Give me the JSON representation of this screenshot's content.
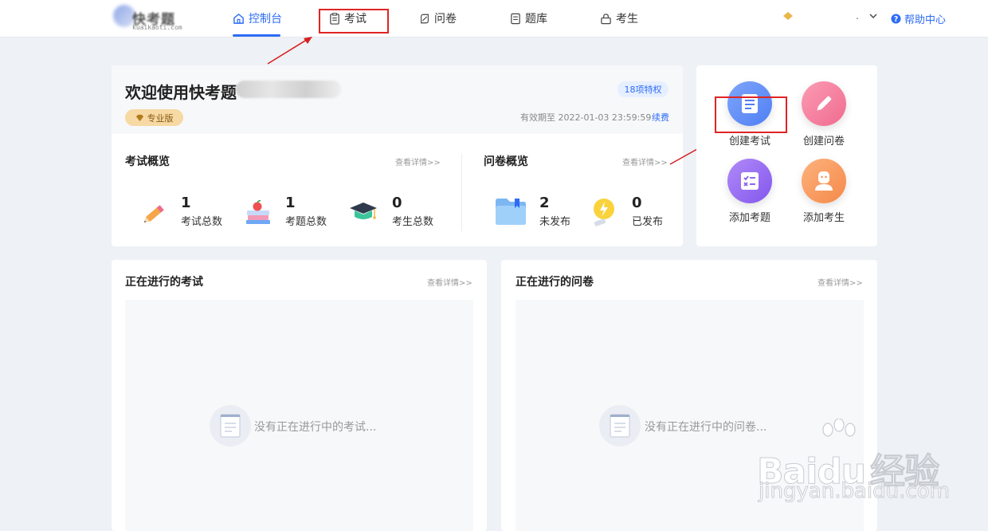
{
  "header": {
    "logo_text": "快考题",
    "logo_sub": "kuaikaoti.com",
    "nav": [
      {
        "label": "控制台",
        "icon": "home-icon",
        "active": true
      },
      {
        "label": "考试",
        "icon": "exam-icon"
      },
      {
        "label": "问卷",
        "icon": "survey-icon"
      },
      {
        "label": "题库",
        "icon": "question-bank-icon"
      },
      {
        "label": "考生",
        "icon": "candidate-icon"
      }
    ],
    "user_name": ".",
    "help_label": "帮助中心",
    "accent": "#2e6cf6"
  },
  "welcome": {
    "title": "欢迎使用快考题",
    "privilege_badge": "18项特权",
    "edition_badge": "专业版",
    "expire_text": "有效期至 2022-01-03 23:59:59",
    "renew_link": "续费"
  },
  "exam_overview": {
    "title": "考试概览",
    "more_link": "查看详情>>",
    "stats": [
      {
        "value": "1",
        "label": "考试总数",
        "icon": "pencil-icon"
      },
      {
        "value": "1",
        "label": "考题总数",
        "icon": "books-apple-icon"
      },
      {
        "value": "0",
        "label": "考生总数",
        "icon": "graduation-cap-icon"
      }
    ]
  },
  "survey_overview": {
    "title": "问卷概览",
    "more_link": "查看详情>>",
    "stats": [
      {
        "value": "2",
        "label": "未发布",
        "icon": "folder-icon"
      },
      {
        "value": "0",
        "label": "已发布",
        "icon": "lightbulb-icon"
      }
    ]
  },
  "quick_actions": [
    {
      "label": "创建考试",
      "icon": "document-icon",
      "color": "#5b8df6"
    },
    {
      "label": "创建问卷",
      "icon": "pen-icon",
      "color": "#f77a9c"
    },
    {
      "label": "添加考题",
      "icon": "checklist-icon",
      "color": "#9a6cf0"
    },
    {
      "label": "添加考生",
      "icon": "person-icon",
      "color": "#f79a5b"
    }
  ],
  "ongoing_exams": {
    "title": "正在进行的考试",
    "more_link": "查看详情>>",
    "empty_text": "没有正在进行中的考试..."
  },
  "ongoing_surveys": {
    "title": "正在进行的问卷",
    "more_link": "查看详情>>",
    "empty_text": "没有正在进行中的问卷..."
  },
  "watermark": {
    "brand": "Bai",
    "brand2": "du",
    "cn": "经验",
    "url": "jingyan.baidu.com"
  }
}
